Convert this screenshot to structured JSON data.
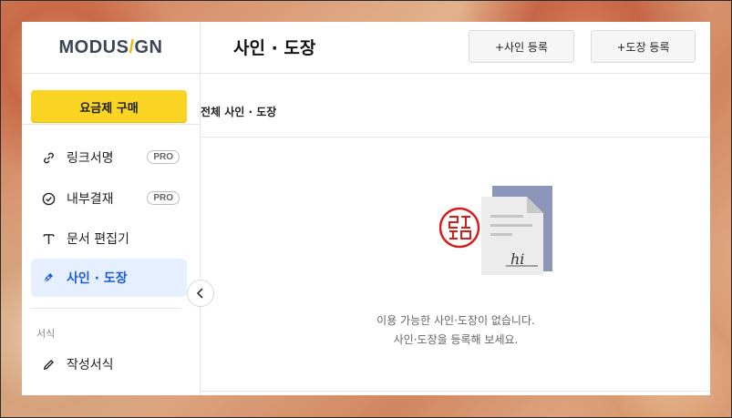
{
  "brand": {
    "logo_text_a": "MODUS",
    "logo_slash": "/",
    "logo_text_b": "GN"
  },
  "sidebar": {
    "buy_button": "요금제 구매",
    "items": [
      {
        "label": "링크서명",
        "icon": "link-icon",
        "badge": "PRO"
      },
      {
        "label": "내부결재",
        "icon": "check-circle-icon",
        "badge": "PRO"
      },
      {
        "label": "문서 편집기",
        "icon": "text-t-icon"
      },
      {
        "label": "사인 · 도장",
        "icon": "pen-nib-icon",
        "active": true
      }
    ],
    "section_label": "서식",
    "section_items": [
      {
        "label": "작성서식",
        "icon": "pencil-icon"
      }
    ]
  },
  "header": {
    "title": "사인 · 도장",
    "register_sign_button": "+사인 등록",
    "register_stamp_button": "+도장 등록"
  },
  "subheader": {
    "title": "전체 사인 · 도장"
  },
  "empty_state": {
    "line1": "이용 가능한 사인·도장이 없습니다.",
    "line2": "사인·도장을 등록해 보세요.",
    "signature_sample": "hi",
    "stamp_color": "#d81c1c"
  },
  "colors": {
    "accent_yellow": "#f9d423",
    "active_blue": "#1a5dd6",
    "active_bg": "#e6efff"
  }
}
